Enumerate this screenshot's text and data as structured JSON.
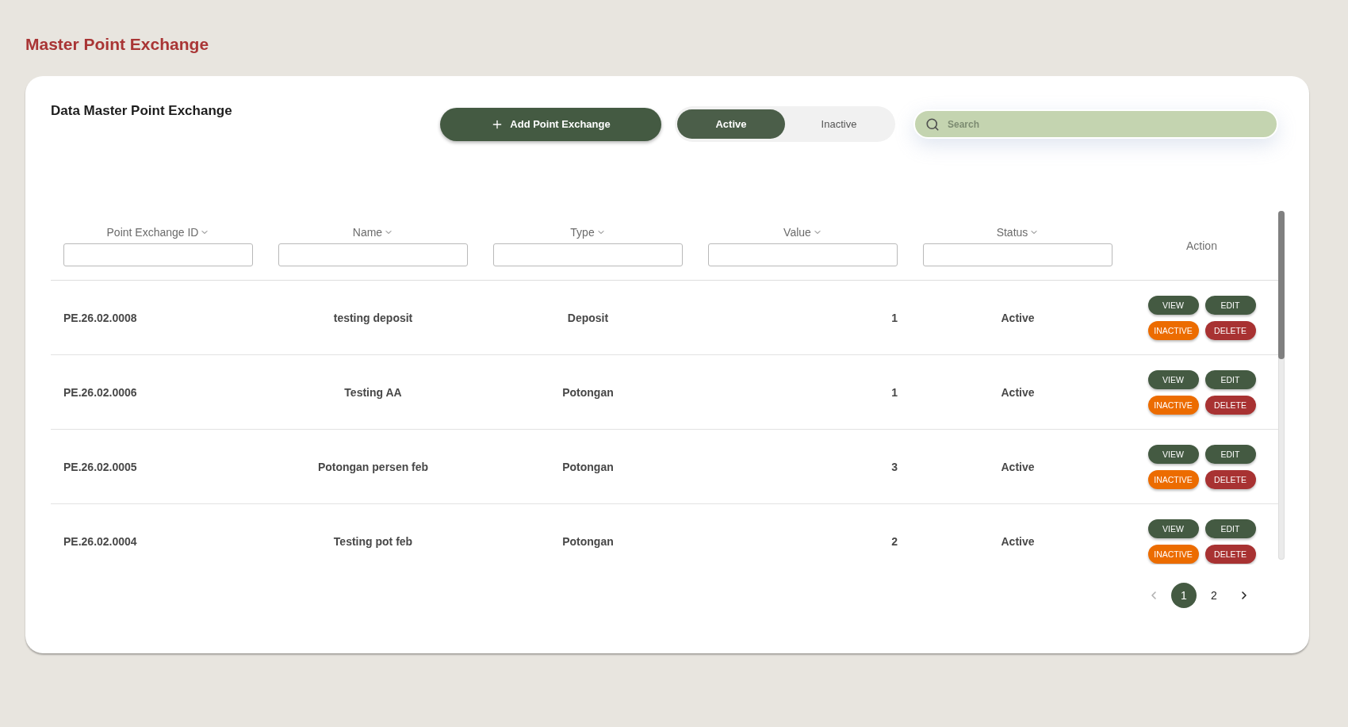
{
  "page": {
    "title": "Master Point Exchange"
  },
  "card": {
    "title": "Data Master Point Exchange",
    "add_button": {
      "label": "Add Point Exchange"
    },
    "status_toggle": [
      {
        "label": "Active",
        "selected": true
      },
      {
        "label": "Inactive",
        "selected": false
      }
    ],
    "search": {
      "placeholder": "Search"
    }
  },
  "table": {
    "columns": [
      {
        "label": "Point Exchange ID",
        "kind": "filter"
      },
      {
        "label": "Name",
        "kind": "filter"
      },
      {
        "label": "Type",
        "kind": "filter"
      },
      {
        "label": "Value",
        "kind": "filter"
      },
      {
        "label": "Status",
        "kind": "filter"
      },
      {
        "label": "Action",
        "kind": "plain"
      }
    ],
    "rows": [
      {
        "cells": [
          "PE.26.02.0008",
          "testing deposit",
          "Deposit",
          "1",
          "Active"
        ],
        "actions": [
          {
            "label": "VIEW",
            "kind": "view"
          },
          {
            "label": "EDIT",
            "kind": "edit"
          },
          {
            "label": "INACTIVE",
            "kind": "inactive"
          },
          {
            "label": "DELETE",
            "kind": "delete"
          }
        ]
      },
      {
        "cells": [
          "PE.26.02.0006",
          "Testing AA",
          "Potongan",
          "1",
          "Active"
        ],
        "actions": [
          {
            "label": "VIEW",
            "kind": "view"
          },
          {
            "label": "EDIT",
            "kind": "edit"
          },
          {
            "label": "INACTIVE",
            "kind": "inactive"
          },
          {
            "label": "DELETE",
            "kind": "delete"
          }
        ]
      },
      {
        "cells": [
          "PE.26.02.0005",
          "Potongan persen feb",
          "Potongan",
          "3",
          "Active"
        ],
        "actions": [
          {
            "label": "VIEW",
            "kind": "view"
          },
          {
            "label": "EDIT",
            "kind": "edit"
          },
          {
            "label": "INACTIVE",
            "kind": "inactive"
          },
          {
            "label": "DELETE",
            "kind": "delete"
          }
        ]
      },
      {
        "cells": [
          "PE.26.02.0004",
          "Testing pot feb",
          "Potongan",
          "2",
          "Active"
        ],
        "actions": [
          {
            "label": "VIEW",
            "kind": "view"
          },
          {
            "label": "EDIT",
            "kind": "edit"
          },
          {
            "label": "INACTIVE",
            "kind": "inactive"
          },
          {
            "label": "DELETE",
            "kind": "delete"
          }
        ]
      }
    ]
  },
  "pagination": {
    "prev": {
      "disabled": true
    },
    "pages": [
      {
        "label": "1",
        "selected": true
      },
      {
        "label": "2",
        "selected": false
      }
    ],
    "next": {
      "disabled": false
    }
  }
}
